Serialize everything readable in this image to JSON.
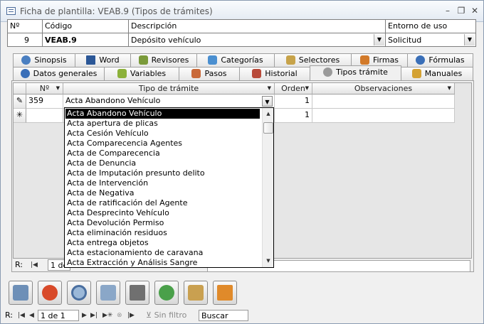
{
  "window": {
    "title": "Ficha de plantilla: VEAB.9 (Tipos de trámites)"
  },
  "header": {
    "labels": {
      "num": "Nº",
      "codigo": "Código",
      "descripcion": "Descripción",
      "entorno": "Entorno de uso"
    },
    "values": {
      "num": "9",
      "codigo": "VEAB.9",
      "descripcion": "Depósito vehículo",
      "entorno": "Solicitud"
    }
  },
  "tabs_row1": [
    "Sinopsis",
    "Word",
    "Revisores",
    "Categorías",
    "Selectores",
    "Firmas",
    "Fórmulas"
  ],
  "tabs_row2": [
    "Datos generales",
    "Variables",
    "Pasos",
    "Historial",
    "Tipos trámite",
    "Manuales"
  ],
  "active_tab": "Tipos trámite",
  "grid": {
    "columns": [
      "Nº",
      "Tipo de trámite",
      "Orden",
      "Observaciones"
    ],
    "rows": [
      {
        "num": "359",
        "tipo": "Acta Abandono Vehículo",
        "orden": "1",
        "obs": ""
      },
      {
        "num": "",
        "tipo": "",
        "orden": "1",
        "obs": ""
      }
    ],
    "record_nav": "1 de"
  },
  "dropdown_options": [
    "Acta Abandono Vehículo",
    "Acta apertura de plicas",
    "Acta Cesión Vehículo",
    "Acta Comparecencia Agentes",
    "Acta de Comparecencia",
    "Acta de Denuncia",
    "Acta de Imputación presunto delito",
    "Acta de Intervención",
    "Acta de Negativa",
    "Acta de ratificación del Agente",
    "Acta Desprecinto Vehículo",
    "Acta Devolución Permiso",
    "Acta eliminación residuos",
    "Acta entrega objetos",
    "Acta estacionamiento de caravana",
    "Acta Extracción y Análisis Sangre"
  ],
  "statusbar": {
    "record_label": "R:",
    "record": "1 de 1",
    "filter": "Sin filtro",
    "search": "Buscar"
  },
  "toolbar_icons": [
    "print-icon",
    "cancel-icon",
    "search-icon",
    "save-icon",
    "folder-icon",
    "refresh-icon",
    "accept-icon",
    "tools-icon"
  ]
}
